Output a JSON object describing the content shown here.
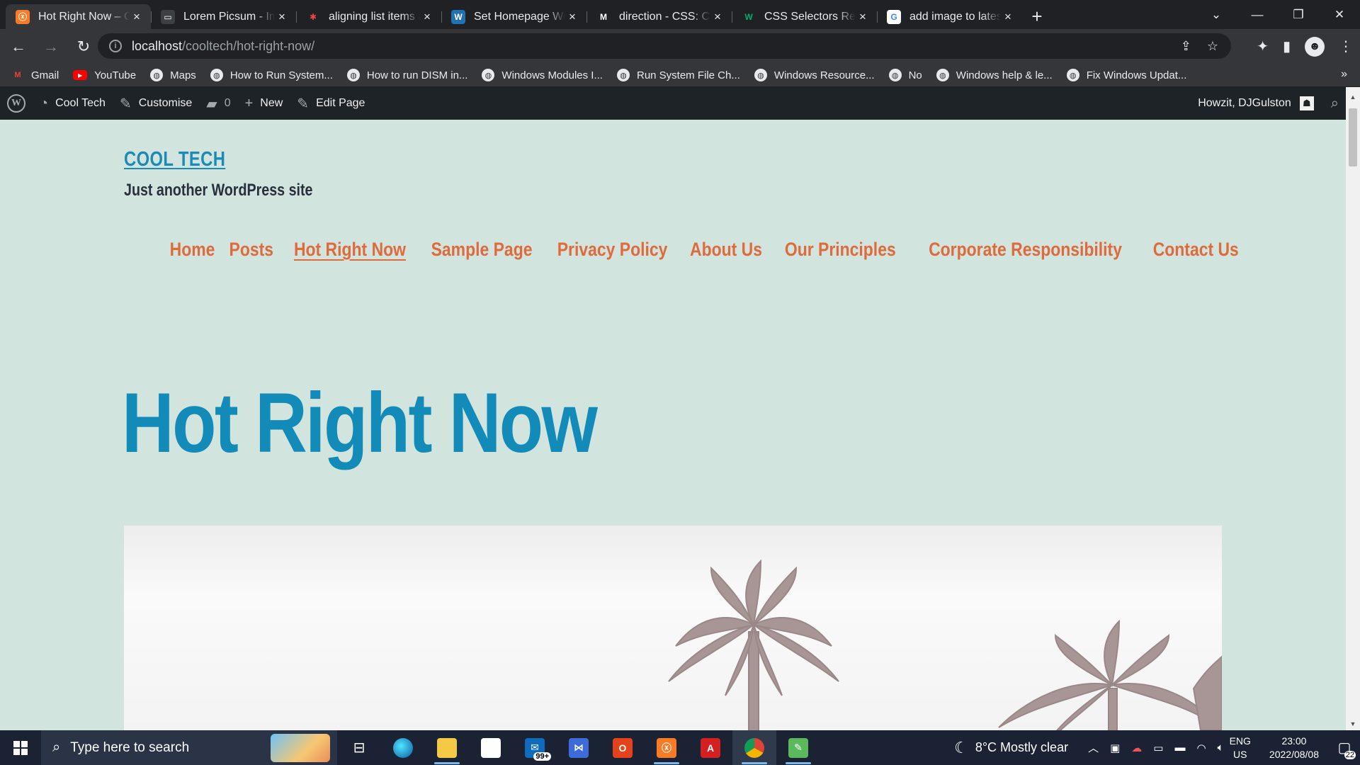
{
  "browser": {
    "tabs": [
      {
        "title": "Hot Right Now – Cool Tech",
        "icon": "xampp-icon",
        "active": true
      },
      {
        "title": "Lorem Picsum - Images",
        "icon": "picsum-icon",
        "active": false
      },
      {
        "title": "aligning list items and",
        "icon": "asterisk-icon",
        "active": false
      },
      {
        "title": "Set Homepage WordPress",
        "icon": "wordpress-icon",
        "active": false
      },
      {
        "title": "direction - CSS: Cascading",
        "icon": "mdn-icon",
        "active": false
      },
      {
        "title": "CSS Selectors Reference",
        "icon": "w3schools-icon",
        "active": false
      },
      {
        "title": "add image to latest post",
        "icon": "google-icon",
        "active": false
      }
    ],
    "new_tab": "+",
    "url_host": "localhost",
    "url_path": "/cooltech/hot-right-now/",
    "bookmarks": [
      {
        "label": "Gmail",
        "icon": "gmail-icon"
      },
      {
        "label": "YouTube",
        "icon": "youtube-icon"
      },
      {
        "label": "Maps",
        "icon": "globe-icon"
      },
      {
        "label": "How to Run System...",
        "icon": "globe-icon"
      },
      {
        "label": "How to run DISM in...",
        "icon": "globe-icon"
      },
      {
        "label": "Windows Modules I...",
        "icon": "globe-icon"
      },
      {
        "label": "Run System File Ch...",
        "icon": "globe-icon"
      },
      {
        "label": "Windows Resource...",
        "icon": "globe-icon"
      },
      {
        "label": "No",
        "icon": "globe-icon"
      },
      {
        "label": "Windows help & le...",
        "icon": "globe-icon"
      },
      {
        "label": "Fix Windows Updat...",
        "icon": "globe-icon"
      }
    ],
    "bookmarks_more": "»"
  },
  "admin_bar": {
    "site_name": "Cool Tech",
    "customise": "Customise",
    "comments_count": "0",
    "new": "New",
    "edit_page": "Edit Page",
    "greeting": "Howzit, DJGulston"
  },
  "site": {
    "title": "COOL TECH",
    "tagline": "Just another WordPress site",
    "nav": [
      {
        "label": "Home",
        "current": false
      },
      {
        "label": "Posts",
        "current": false
      },
      {
        "label": "Hot Right Now",
        "current": true
      },
      {
        "label": "Sample Page",
        "current": false
      },
      {
        "label": "Privacy Policy",
        "current": false
      },
      {
        "label": "About Us",
        "current": false
      },
      {
        "label": "Our Principles",
        "current": false
      },
      {
        "label": "Corporate Responsibility",
        "current": false
      },
      {
        "label": "Contact Us",
        "current": false
      }
    ],
    "page_title": "Hot Right Now"
  },
  "taskbar": {
    "search_placeholder": "Type here to search",
    "mail_badge": "99+",
    "weather": "8°C  Mostly clear",
    "lang_1": "ENG",
    "lang_2": "US",
    "time": "23:00",
    "date": "2022/08/08",
    "notifications": "22"
  },
  "colors": {
    "page_bg": "#d1e4dd",
    "site_title": "#1b8ab6",
    "nav_link": "#e06a3b",
    "hero_title": "#138bb8",
    "admin_bar": "#1d2327"
  }
}
